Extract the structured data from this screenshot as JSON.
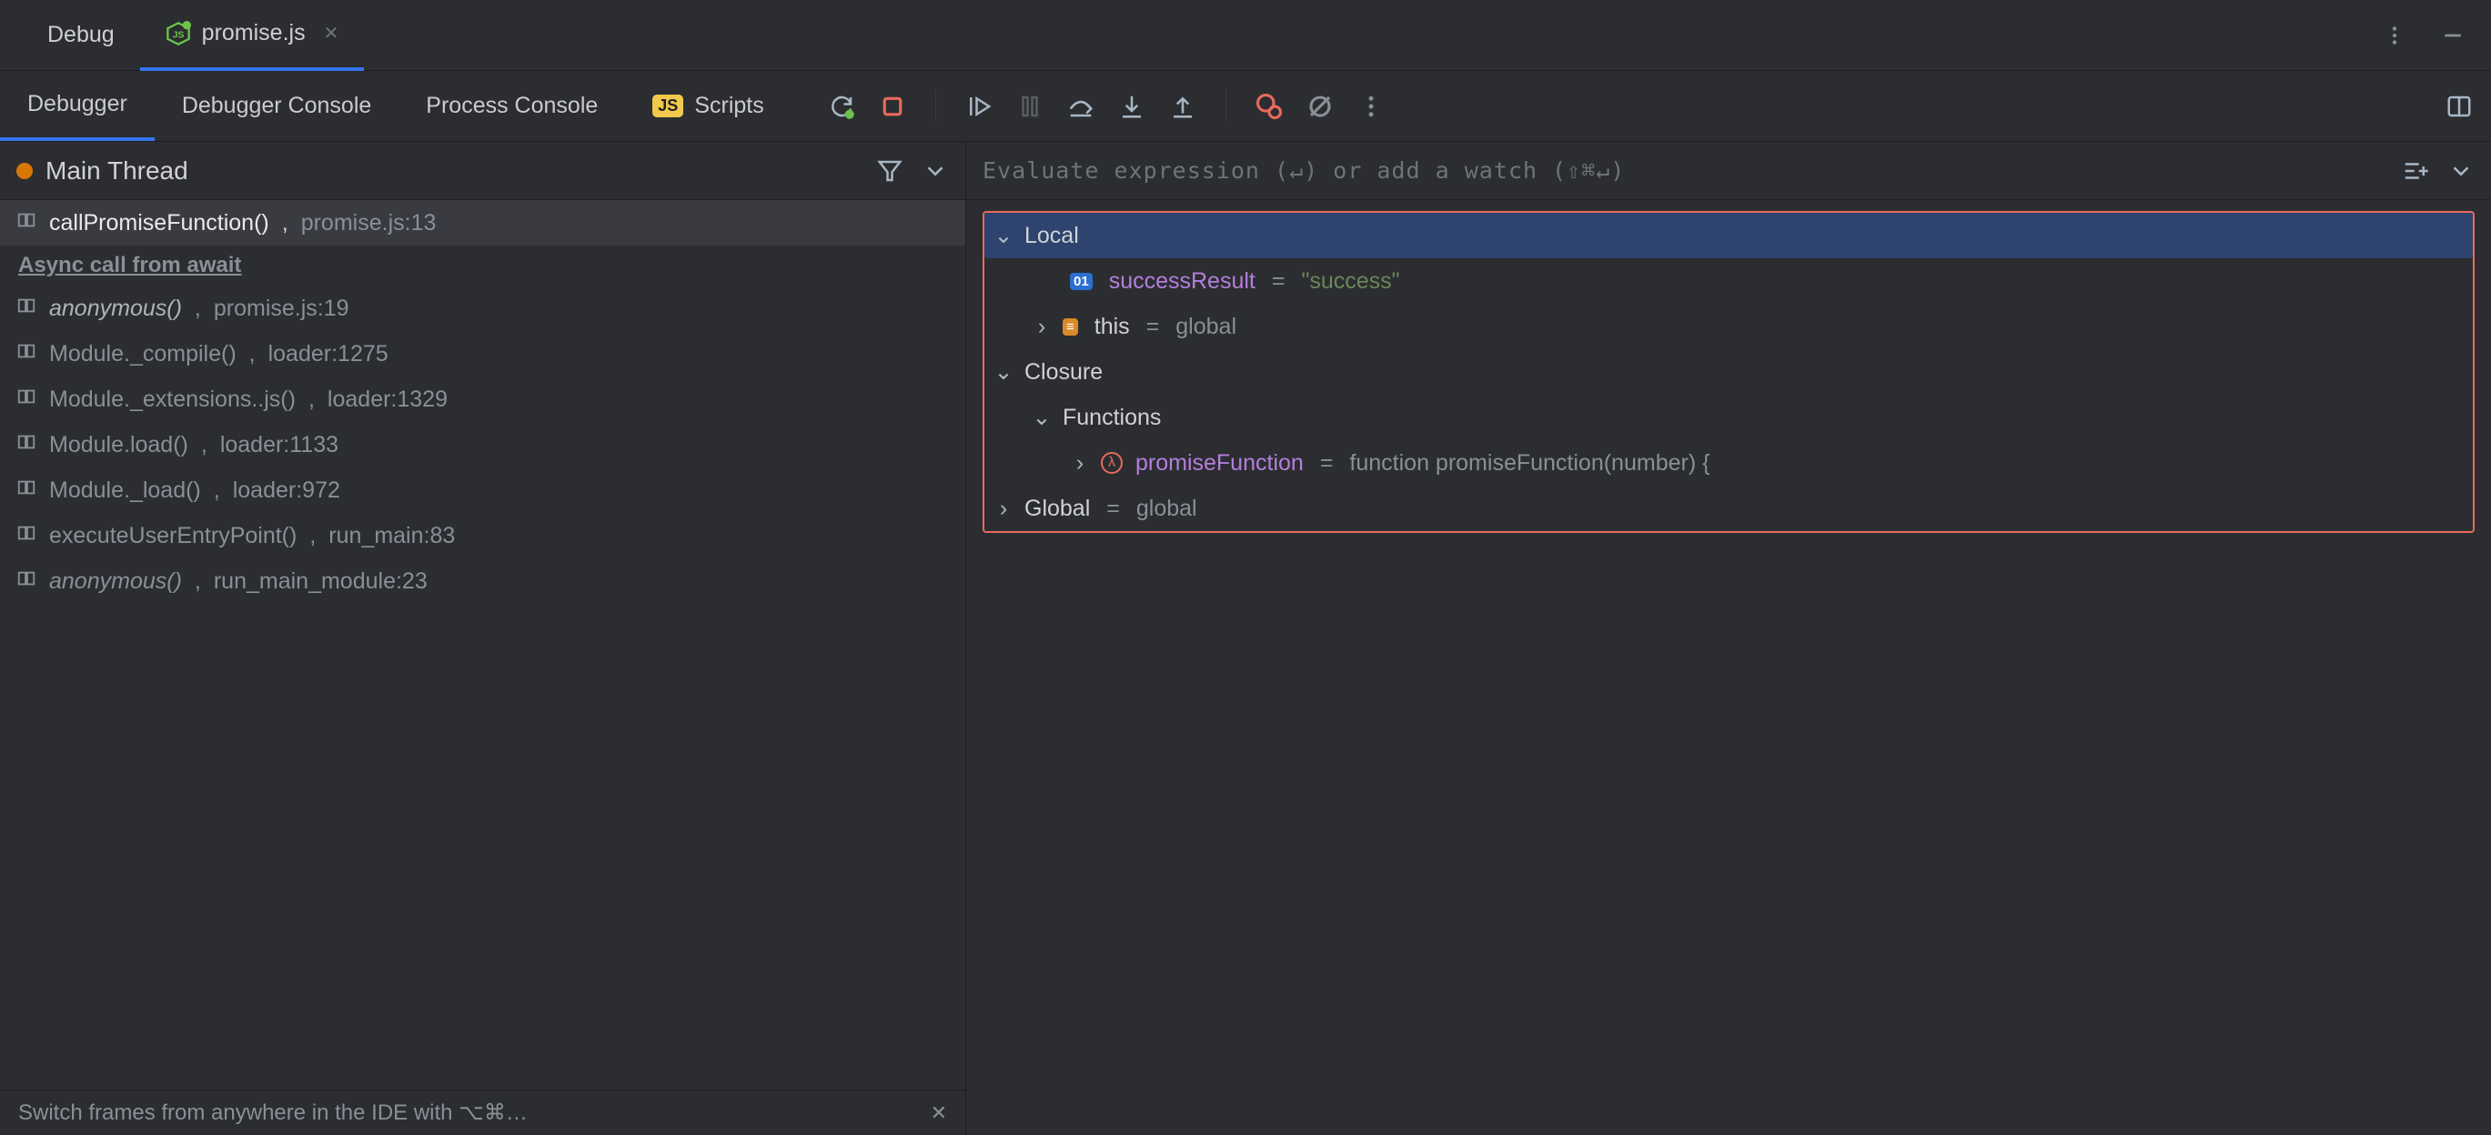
{
  "toolTabs": {
    "debug": "Debug",
    "file": "promise.js"
  },
  "subTabs": {
    "debugger": "Debugger",
    "console": "Debugger Console",
    "process": "Process Console",
    "scripts": "Scripts"
  },
  "thread": "Main Thread",
  "frames": [
    {
      "fn": "callPromiseFunction()",
      "loc": "promise.js:13",
      "selected": true,
      "italic": false
    },
    {
      "fn": "anonymous()",
      "loc": "promise.js:19",
      "italic": true
    },
    {
      "fn": "Module._compile()",
      "loc": "loader:1275",
      "dim": true
    },
    {
      "fn": "Module._extensions..js()",
      "loc": "loader:1329",
      "dim": true
    },
    {
      "fn": "Module.load()",
      "loc": "loader:1133",
      "dim": true
    },
    {
      "fn": "Module._load()",
      "loc": "loader:972",
      "dim": true
    },
    {
      "fn": "executeUserEntryPoint()",
      "loc": "run_main:83",
      "dim": true
    },
    {
      "fn": "anonymous()",
      "loc": "run_main_module:23",
      "italic": true,
      "dim": true
    }
  ],
  "asyncLabel": "Async call from await",
  "tip": "Switch frames from anywhere in the IDE with ⌥⌘…",
  "watchPlaceholder": "Evaluate expression (↵) or add a watch (⇧⌘↵)",
  "scopes": {
    "local": "Local",
    "closure": "Closure",
    "functions": "Functions",
    "global": "Global"
  },
  "vars": {
    "successResult": {
      "name": "successResult",
      "value": "\"success\""
    },
    "this": {
      "name": "this",
      "value": "global"
    },
    "promiseFunction": {
      "name": "promiseFunction",
      "value": "function promiseFunction(number) {"
    },
    "global": {
      "name": "Global",
      "value": "global"
    }
  }
}
